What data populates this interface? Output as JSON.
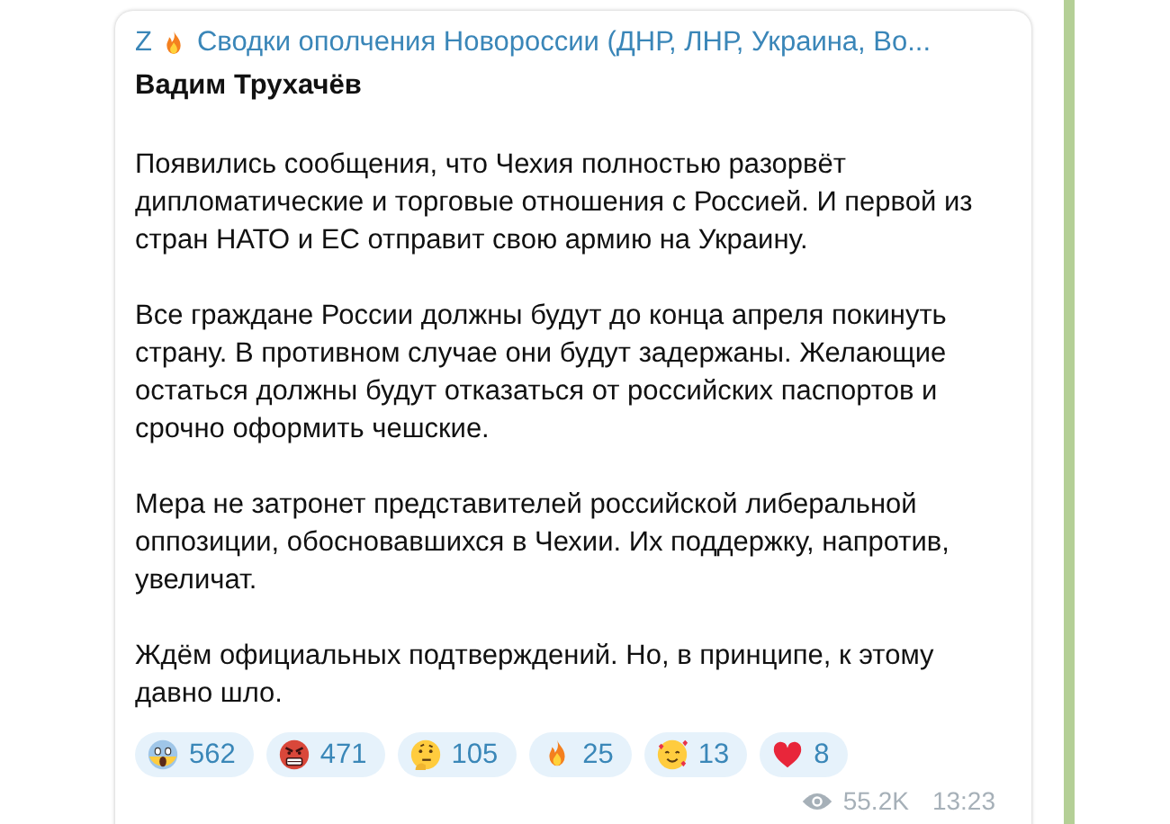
{
  "message": {
    "forwarded_from": {
      "prefix": "Z",
      "name": "Сводки ополчения Новороссии (ДНР, ЛНР, Украина, Во..."
    },
    "author": "Вадим Трухачёв",
    "paragraphs": [
      "Появились сообщения, что Чехия полностью разорвёт дипломатические и торговые отношения с Россией. И первой из стран НАТО и ЕС отправит свою армию на Украину.",
      "Все граждане России должны будут до конца апреля покинуть страну. В противном случае они будут задержаны. Желающие остаться должны будут отказаться от российских паспортов и срочно оформить чешские.",
      "Мера не затронет представителей российской либеральной оппозиции, обосновавшихся в Чехии. Их поддержку, напротив, увеличат.",
      "Ждём официальных подтверждений. Но, в принципе, к этому давно шло."
    ],
    "reactions": [
      {
        "kind": "scream",
        "count": "562"
      },
      {
        "kind": "angry",
        "count": "471"
      },
      {
        "kind": "thinking",
        "count": "105"
      },
      {
        "kind": "fire",
        "count": "25"
      },
      {
        "kind": "hearts",
        "count": "13"
      },
      {
        "kind": "heart",
        "count": "8"
      }
    ],
    "views": "55.2K",
    "time": "13:23"
  }
}
